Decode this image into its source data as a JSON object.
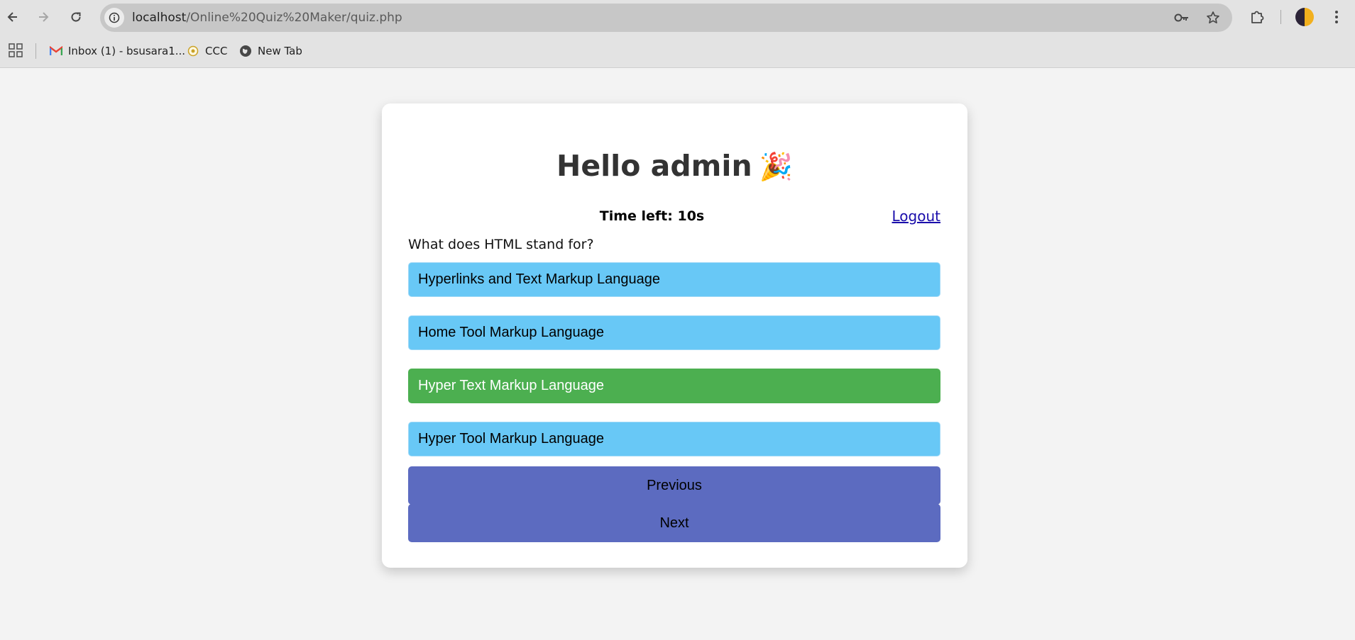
{
  "browser": {
    "url_host": "localhost",
    "url_path": "/Online%20Quiz%20Maker/quiz.php",
    "bookmarks": [
      {
        "label": "Inbox (1) - bsusara1...",
        "icon": "gmail-icon"
      },
      {
        "label": "CCC",
        "icon": "ccc-favicon-icon"
      },
      {
        "label": "New Tab",
        "icon": "globe-icon"
      }
    ]
  },
  "page": {
    "greeting": "Hello admin",
    "greeting_emoji": "🎉",
    "timer": "Time left: 10s",
    "logout_label": "Logout",
    "question": "What does HTML stand for?",
    "options": [
      {
        "label": "Hyperlinks and Text Markup Language",
        "selected": false
      },
      {
        "label": "Home Tool Markup Language",
        "selected": false
      },
      {
        "label": "Hyper Text Markup Language",
        "selected": true
      },
      {
        "label": "Hyper Tool Markup Language",
        "selected": false
      }
    ],
    "previous_label": "Previous",
    "next_label": "Next"
  },
  "colors": {
    "option": "#68c8f6",
    "option_selected": "#4caf50",
    "nav_button": "#5c6bc0",
    "page_bg": "#f3f3f3"
  }
}
